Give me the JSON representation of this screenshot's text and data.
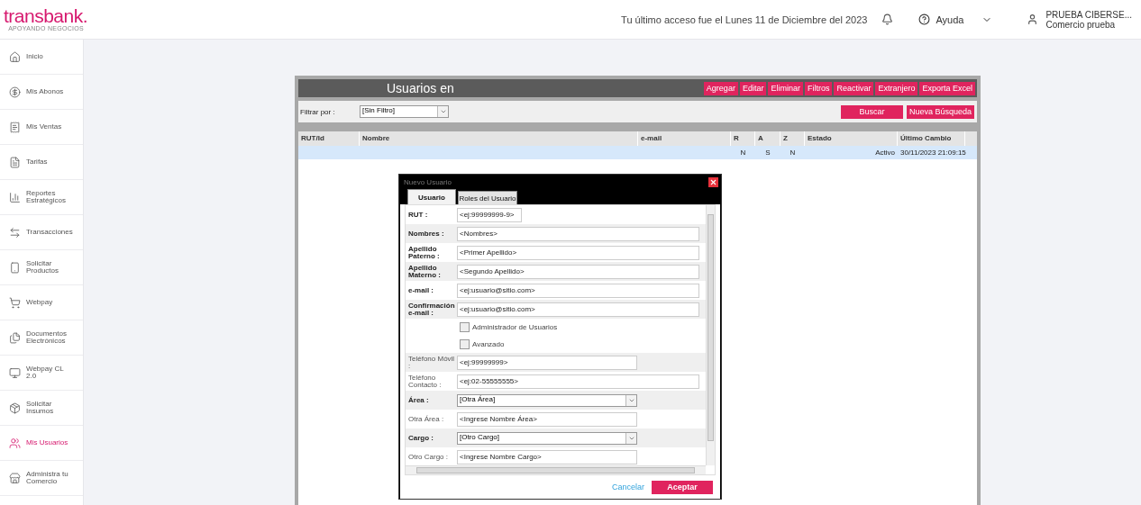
{
  "header": {
    "logo": "transbank.",
    "logo_tagline": "APOYANDO NEGOCIOS",
    "last_access": "Tu último acceso fue el Lunes 11 de Diciembre del 2023",
    "help": "Ayuda",
    "user_name": "PRUEBA CIBERSE...",
    "user_company": "Comercio prueba"
  },
  "sidebar": {
    "items": [
      {
        "label": "Inicio",
        "selected": false
      },
      {
        "label": "Mis Abonos",
        "selected": false
      },
      {
        "label": "Mis Ventas",
        "selected": false
      },
      {
        "label": "Tarifas",
        "selected": false
      },
      {
        "label": "Reportes Estratégicos",
        "selected": false
      },
      {
        "label": "Transacciones",
        "selected": false
      },
      {
        "label": "Solicitar Productos",
        "selected": false
      },
      {
        "label": "Webpay",
        "selected": false
      },
      {
        "label": "Documentos Electrónicos",
        "selected": false
      },
      {
        "label": "Webpay CL 2.0",
        "selected": false
      },
      {
        "label": "Solicitar Insumos",
        "selected": false
      },
      {
        "label": "Mis Usuarios",
        "selected": true
      },
      {
        "label": "Administra tu Comercio",
        "selected": false
      }
    ]
  },
  "panel": {
    "title": "Usuarios en",
    "actions": [
      "Agregar",
      "Editar",
      "Eliminar",
      "Filtros",
      "Reactivar",
      "Extranjero",
      "Exporta Excel"
    ],
    "filter": {
      "label": "Filtrar por :",
      "value": "[Sin Filtro]",
      "search": "Buscar",
      "new_search": "Nueva Búsqueda"
    },
    "table": {
      "columns": [
        "RUT/Id",
        "Nombre",
        "e-mail",
        "R",
        "A",
        "Z",
        "Estado",
        "Último Cambio"
      ],
      "rows": [
        {
          "selected": true,
          "r": "N",
          "a": "S",
          "z": "N",
          "estado": "Activo",
          "ultimo_cambio": "30/11/2023 21:09:15"
        }
      ]
    }
  },
  "dialog": {
    "title": "Nuevo Usuario",
    "tabs": [
      {
        "label": "Usuario",
        "selected": true
      },
      {
        "label": "Roles del Usuario",
        "selected": false
      }
    ],
    "fields": [
      {
        "kind": "text",
        "label": "RUT :",
        "bold": true,
        "placeholder": "<ej:99999999-9>"
      },
      {
        "kind": "text",
        "label": "Nombres :",
        "bold": true,
        "placeholder": "<Nombres>"
      },
      {
        "kind": "text",
        "label": "Apellido Paterno :",
        "bold": true,
        "placeholder": "<Primer Apellido>"
      },
      {
        "kind": "text",
        "label": "Apellido Materno :",
        "bold": true,
        "placeholder": "<Segundo Apellido>"
      },
      {
        "kind": "text",
        "label": "e-mail :",
        "bold": true,
        "placeholder": "<ej:usuario@sitio.com>"
      },
      {
        "kind": "text",
        "label": "Confirmación e-mail :",
        "bold": true,
        "placeholder": "<ej:usuario@sitio.com>"
      },
      {
        "kind": "checkbox",
        "label": "Administrador de Usuarios",
        "checked": false
      },
      {
        "kind": "checkbox",
        "label": "Avanzado",
        "checked": false
      },
      {
        "kind": "text",
        "label": "Teléfono Móvil :",
        "bold": false,
        "placeholder": "<ej:99999999>"
      },
      {
        "kind": "text",
        "label": "Teléfono Contacto :",
        "bold": false,
        "placeholder": "<ej:02-55555555>"
      },
      {
        "kind": "select",
        "label": "Área :",
        "bold": true,
        "value": "[Otra Área]"
      },
      {
        "kind": "text",
        "label": "Otra Área :",
        "bold": false,
        "placeholder": "<Ingrese Nombre Área>"
      },
      {
        "kind": "select",
        "label": "Cargo :",
        "bold": true,
        "value": "[Otro Cargo]"
      },
      {
        "kind": "text",
        "label": "Otro Cargo :",
        "bold": false,
        "placeholder": "<Ingrese Nombre Cargo>"
      }
    ],
    "cancel": "Cancelar",
    "accept": "Aceptar"
  }
}
